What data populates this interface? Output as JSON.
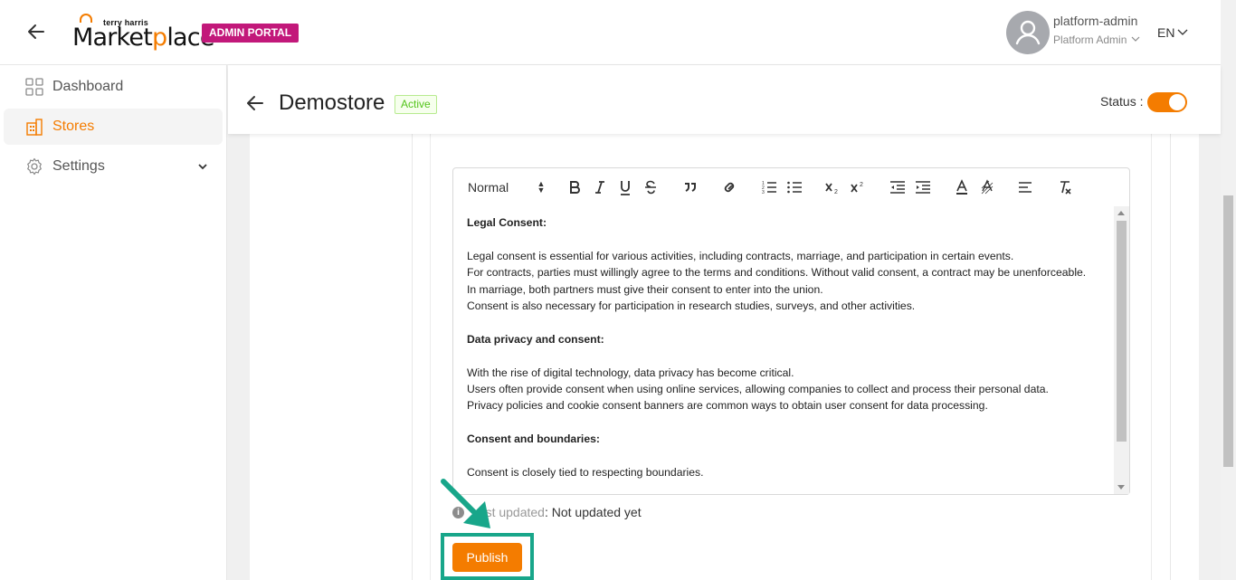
{
  "header": {
    "logo_small": "terry harris",
    "logo_big_pre": "Market",
    "logo_big_o": "p",
    "logo_big_post": "lace",
    "portal_badge": "ADMIN PORTAL",
    "user_name": "platform-admin",
    "user_role": "Platform Admin",
    "language": "EN"
  },
  "sidebar": {
    "items": [
      {
        "label": "Dashboard",
        "icon": "dashboard-icon"
      },
      {
        "label": "Stores",
        "icon": "stores-icon",
        "active": true
      },
      {
        "label": "Settings",
        "icon": "gear-icon"
      }
    ]
  },
  "page": {
    "title": "Demostore",
    "status_badge": "Active",
    "status_label": "Status :",
    "status_on": true
  },
  "editor": {
    "format_select": "Normal",
    "content": {
      "h1": "Legal Consent:",
      "p1": [
        "Legal consent is essential for various activities, including contracts, marriage, and participation in certain events.",
        "For contracts, parties must willingly agree to the terms and conditions. Without valid consent, a contract may be unenforceable.",
        "In marriage, both partners must give their consent to enter into the union.",
        "Consent is also necessary for participation in research studies, surveys, and other activities."
      ],
      "h2": "Data privacy and consent:",
      "p2": [
        "With the rise of digital technology, data privacy has become critical.",
        "Users often provide consent when using online services, allowing companies to collect and process their personal data.",
        "Privacy policies and cookie consent banners are common ways to obtain user consent for data processing."
      ],
      "h3": "Consent and boundaries:",
      "p3": [
        "Consent is closely tied to respecting boundaries."
      ]
    }
  },
  "footer": {
    "last_updated_label": "Last updated",
    "last_updated_value": ": Not updated yet",
    "publish_label": "Publish"
  },
  "colors": {
    "accent": "#f47c00",
    "portal_badge": "#c2187a",
    "annotation": "#18a68a",
    "active_badge": "#52c41a"
  }
}
